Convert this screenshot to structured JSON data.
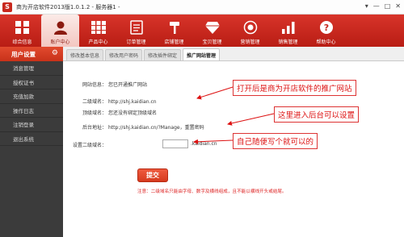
{
  "window": {
    "title": "商为开店软件2013版1.0.1.2 - 服务器1 -",
    "controls": [
      "▾",
      "—",
      "□",
      "✕"
    ]
  },
  "topnav": {
    "items": [
      {
        "label": "综合信息",
        "icon": "grid-icon"
      },
      {
        "label": "账户中心",
        "icon": "account-icon",
        "active": true
      },
      {
        "label": "产品中心",
        "icon": "apps-icon"
      },
      {
        "label": "订单管理",
        "icon": "order-icon"
      },
      {
        "label": "店铺管理",
        "icon": "hammer-icon"
      },
      {
        "label": "宝贝管理",
        "icon": "gem-icon"
      },
      {
        "label": "营销管理",
        "icon": "marketing-icon"
      },
      {
        "label": "销售管理",
        "icon": "sales-icon"
      },
      {
        "label": "帮助中心",
        "icon": "help-icon"
      }
    ]
  },
  "sidebar": {
    "header": "用户设置",
    "items": [
      "消息管理",
      "授权证书",
      "充值加款",
      "操作日志",
      "注销登录",
      "退出系统"
    ]
  },
  "tabs": [
    "修改基本信息",
    "修改用户密码",
    "修改插件绑定",
    "推广网站管理"
  ],
  "form": {
    "site_info_label": "网站信息：",
    "site_info_value": "您已开通推广网站",
    "subdomain_label": "二级域名：",
    "subdomain_value": "http://shj.kaidian.cn",
    "top_domain_label": "顶级域名：",
    "top_domain_value": "您还没有绑定顶级域名",
    "admin_label": "后台地址：",
    "admin_value": "http://shj.kaidian.cn/?Manage，重置密码",
    "set_subdomain_label": "设置二级域名：",
    "set_subdomain_suffix": ".kaidian.cn",
    "submit_label": "提交",
    "notice": "注意：二级域名只能由字母、数字及横线组成，且不能以横线开头或结尾。"
  },
  "callouts": {
    "promo_site": "打开后是商为开店软件的推广网站",
    "backend": "这里进入后台可以设置",
    "free_write": "自己随便写个就可以的"
  }
}
